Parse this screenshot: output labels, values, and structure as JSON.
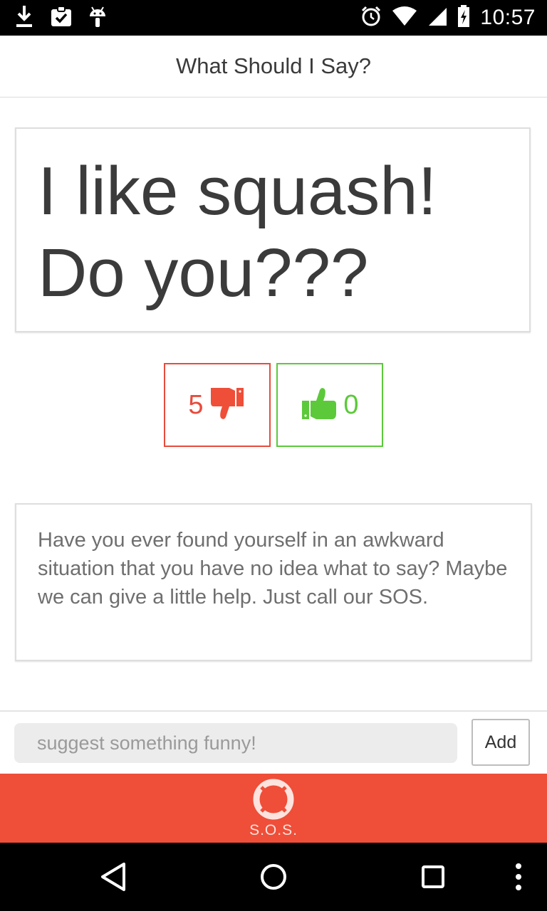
{
  "status_bar": {
    "time": "10:57",
    "left_icons": [
      "download-icon",
      "clipboard-check-icon",
      "android-icon"
    ],
    "right_icons": [
      "alarm-icon",
      "wifi-icon",
      "signal-icon",
      "battery-charging-icon"
    ]
  },
  "header": {
    "title": "What Should I Say?"
  },
  "phrase": {
    "text": "I like squash! Do you???"
  },
  "votes": {
    "down_count": "5",
    "up_count": "0",
    "down_icon": "thumbs-down-icon",
    "up_icon": "thumbs-up-icon",
    "down_color": "#e74c3c",
    "up_color": "#5cc93a"
  },
  "info": {
    "text": "Have you ever found yourself in an awkward situation that you have no idea what to say? Maybe we can give a little help. Just call our SOS."
  },
  "suggest": {
    "placeholder": "suggest something funny!",
    "add_label": "Add"
  },
  "sos": {
    "label": "S.O.S.",
    "icon": "lifebuoy-icon",
    "color": "#ef4e39"
  },
  "nav": {
    "icons": [
      "back-icon",
      "home-icon",
      "recents-icon",
      "menu-icon"
    ]
  }
}
